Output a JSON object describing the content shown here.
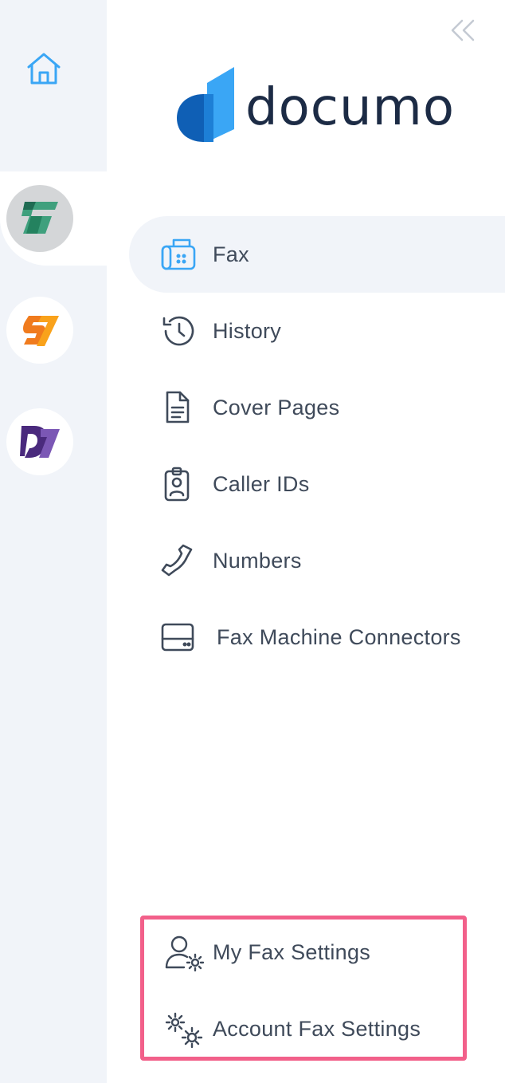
{
  "brand": {
    "name": "documo",
    "colors": {
      "accent": "#3aa6f5",
      "dark": "#1c2b45",
      "highlight_border": "#f2608a",
      "rail_bg": "#f1f4f9"
    }
  },
  "rail": {
    "items": [
      {
        "name": "home",
        "icon": "home-icon"
      },
      {
        "name": "fax-app",
        "icon": "fax-app-logo",
        "active": true
      },
      {
        "name": "s7-app",
        "icon": "s7-app-logo"
      },
      {
        "name": "dj-app",
        "icon": "dj-app-logo"
      }
    ]
  },
  "nav": {
    "items": [
      {
        "label": "Fax",
        "icon": "fax-machine-icon",
        "active": true
      },
      {
        "label": "History",
        "icon": "history-icon"
      },
      {
        "label": "Cover Pages",
        "icon": "document-icon"
      },
      {
        "label": "Caller IDs",
        "icon": "id-badge-icon"
      },
      {
        "label": "Numbers",
        "icon": "phone-icon"
      },
      {
        "label": "Fax Machine Connectors",
        "icon": "connector-icon"
      }
    ]
  },
  "settings": {
    "my_fax": {
      "label": "My Fax Settings",
      "icon": "user-gear-icon"
    },
    "account_fax": {
      "label": "Account Fax Settings",
      "icon": "gears-icon"
    }
  }
}
